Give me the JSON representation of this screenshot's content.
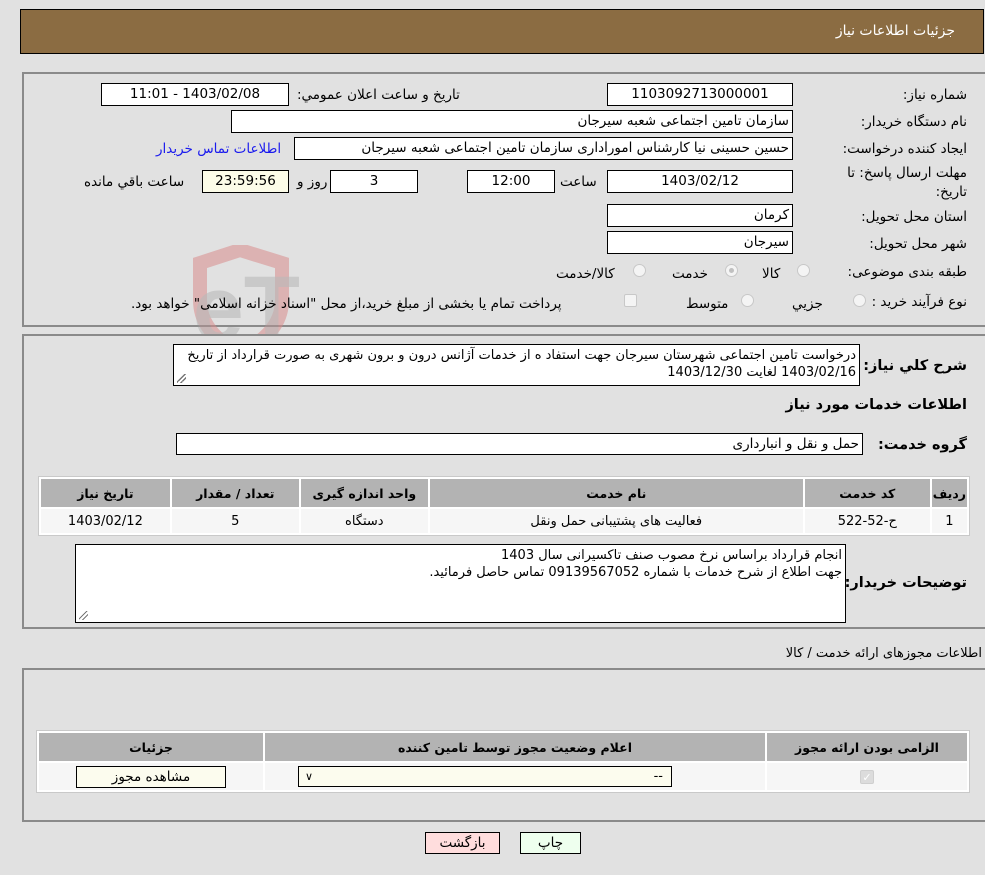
{
  "header": {
    "title": "جزئیات اطلاعات نیاز"
  },
  "form": {
    "need_number_label": "شماره نیاز:",
    "need_number": "1103092713000001",
    "announce_label": "تاریخ و ساعت اعلان عمومي:",
    "announce_value": "1403/02/08 - 11:01",
    "buyer_org_label": "نام دستگاه خریدار:",
    "buyer_org": "سازمان تامین اجتماعی شعبه سیرجان",
    "creator_label": "ایجاد کننده درخواست:",
    "creator": "حسین حسینی نیا کارشناس اموراداری سازمان تامین اجتماعی شعبه سیرجان",
    "contact_link": "اطلاعات تماس خریدار",
    "deadline_label": "مهلت ارسال پاسخ: تا تاریخ:",
    "deadline_date": "1403/02/12",
    "time_label": "ساعت",
    "deadline_time": "12:00",
    "days": "3",
    "days_label": "روز و",
    "remaining": "23:59:56",
    "remaining_label": "ساعت باقي مانده",
    "province_label": "استان محل تحویل:",
    "province": "کرمان",
    "city_label": "شهر محل تحویل:",
    "city": "سیرجان",
    "category_label": "طبقه بندی موضوعی:",
    "category_options": [
      {
        "label": "کالا",
        "selected": false
      },
      {
        "label": "خدمت",
        "selected": true
      },
      {
        "label": "کالا/خدمت",
        "selected": false
      }
    ],
    "process_label": "نوع فرآیند خرید :",
    "process_options": [
      {
        "label": "جزيي",
        "selected": false
      },
      {
        "label": "متوسط",
        "selected": false
      }
    ],
    "payment_note": "پرداخت تمام یا بخشی از مبلغ خرید،از محل \"اسناد خزانه اسلامی\" خواهد بود."
  },
  "description": {
    "label": "شرح کلي نیاز:",
    "text": "درخواست تامین اجتماعی شهرستان سیرجان جهت استفاد ه از خدمات  آژانس درون و برون شهری به صورت قرارداد از تاریخ 1403/02/16 لغایت 1403/12/30",
    "services_title": "اطلاعات خدمات مورد نیاز",
    "group_label": "گروه خدمت:",
    "group_value": "حمل و نقل و انبارداری"
  },
  "services_table": {
    "headers": [
      "ردیف",
      "کد خدمت",
      "نام خدمت",
      "واحد اندازه گیری",
      "تعداد / مقدار",
      "تاریخ نیاز"
    ],
    "rows": [
      [
        "1",
        "ح-52-522",
        "فعالیت های پشتیبانی حمل ونقل",
        "دستگاه",
        "5",
        "1403/02/12"
      ]
    ]
  },
  "buyer_notes": {
    "label": "توضیحات خریدار:",
    "line1": "انجام قرارداد براساس نرخ مصوب صنف تاکسیرانی سال 1403",
    "line2": "جهت اطلاع از شرح خدمات با شماره 09139567052 تماس حاصل فرمائید."
  },
  "permits": {
    "title": "اطلاعات مجوزهای ارائه خدمت / کالا",
    "headers": [
      "الزامی بودن ارائه مجوز",
      "اعلام وضعیت مجوز توسط تامین کننده",
      "جزئیات"
    ],
    "row": {
      "required_checked": true,
      "status_value": "--",
      "view_button": "مشاهده مجوز"
    }
  },
  "footer": {
    "print_button": "چاپ",
    "back_button": "بازگشت"
  },
  "colors": {
    "header_bg": "#8b6c42",
    "link": "#1a1aee",
    "print_bg": "#eeffee",
    "back_bg": "#ffdddd"
  }
}
